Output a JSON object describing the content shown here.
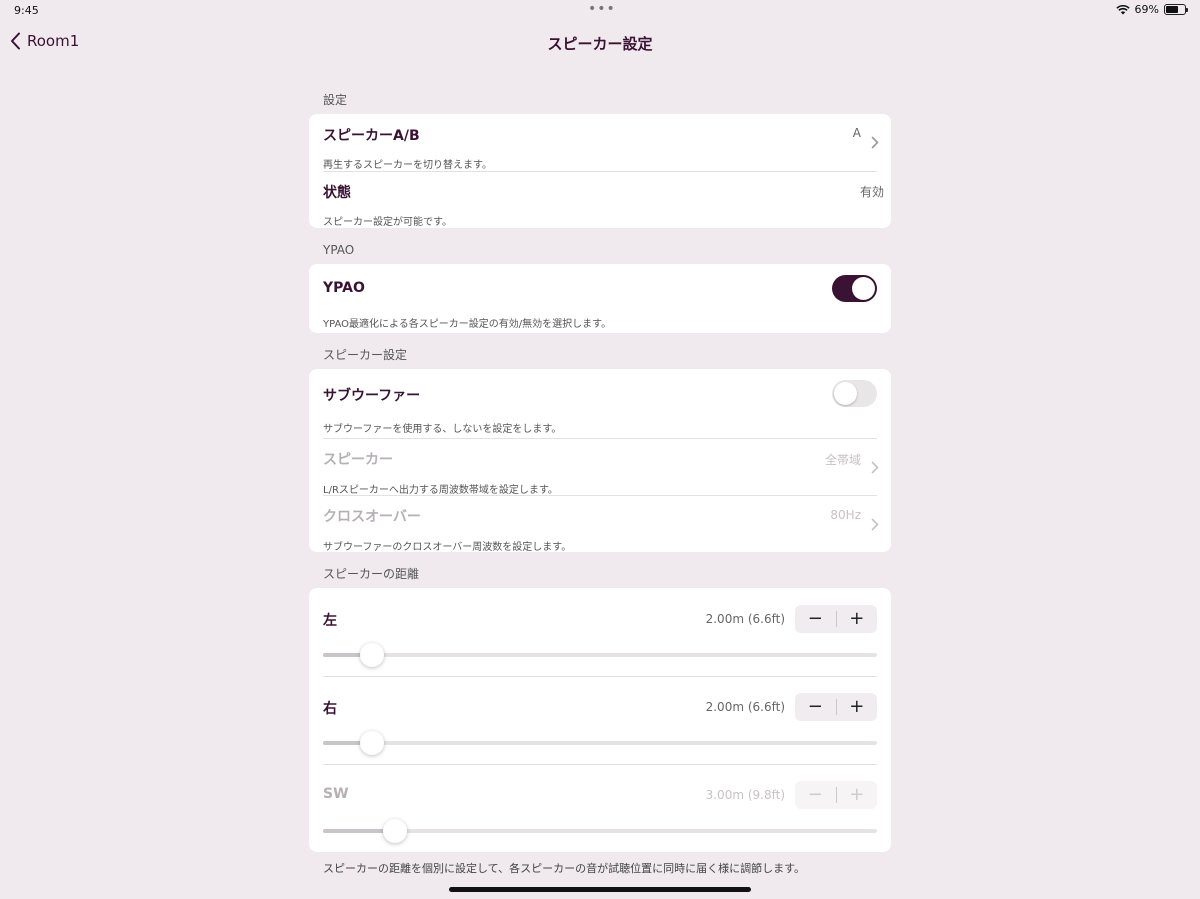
{
  "status_bar": {
    "time": "9:45",
    "dots": "•••",
    "battery_text": "69%",
    "battery_level": 0.69
  },
  "nav": {
    "back_label": "Room1",
    "title": "スピーカー設定"
  },
  "sections": {
    "settings": {
      "header": "設定",
      "speaker_ab": {
        "title": "スピーカーA/B",
        "desc": "再生するスピーカーを切り替えます。",
        "value": "A"
      },
      "state": {
        "title": "状態",
        "desc": "スピーカー設定が可能です。",
        "value": "有効"
      }
    },
    "ypao": {
      "header": "YPAO",
      "row": {
        "title": "YPAO",
        "desc": "YPAO最適化による各スピーカー設定の有効/無効を選択します。",
        "enabled": true
      }
    },
    "speaker_settings": {
      "header": "スピーカー設定",
      "subwoofer": {
        "title": "サブウーファー",
        "desc": "サブウーファーを使用する、しないを設定をします。",
        "enabled": false
      },
      "speaker": {
        "title": "スピーカー",
        "desc": "L/Rスピーカーへ出力する周波数帯域を設定します。",
        "value": "全帯域"
      },
      "crossover": {
        "title": "クロスオーバー",
        "desc": "サブウーファーのクロスオーバー周波数を設定します。",
        "value": "80Hz"
      }
    },
    "distance": {
      "header": "スピーカーの距離",
      "left": {
        "title": "左",
        "value": "2.00m (6.6ft)",
        "level": 0.088
      },
      "right": {
        "title": "右",
        "value": "2.00m (6.6ft)",
        "level": 0.088
      },
      "sw": {
        "title": "SW",
        "value": "3.00m (9.8ft)",
        "level": 0.13
      },
      "minus": "−",
      "plus": "+",
      "footer": "スピーカーの距離を個別に設定して、各スピーカーの音が試聴位置に同時に届く様に調節します。"
    }
  },
  "colors": {
    "accent": "#3a1234",
    "background": "#f0eaee"
  }
}
